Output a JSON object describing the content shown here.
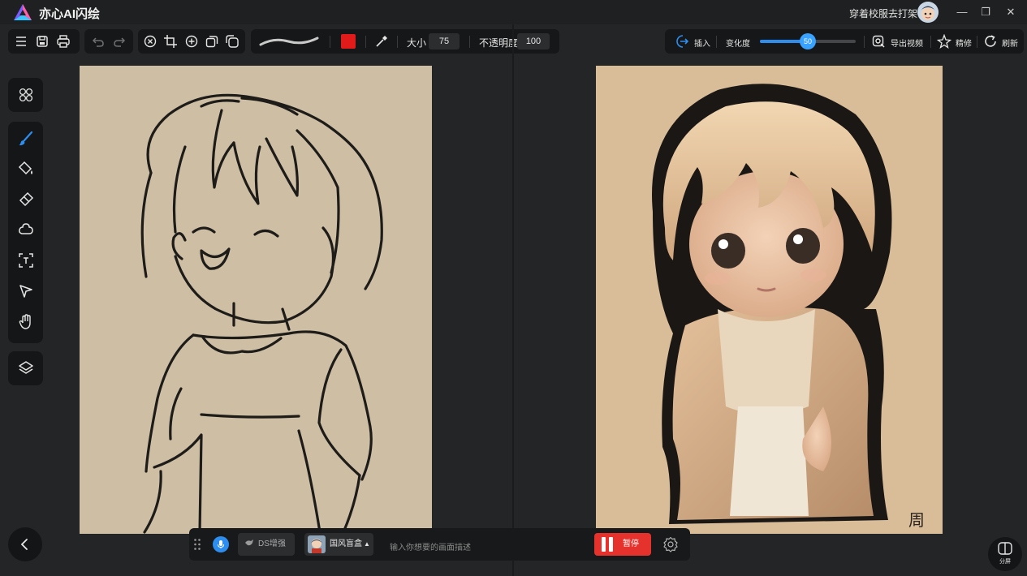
{
  "app": {
    "title": "亦心AI闪绘"
  },
  "user": {
    "name": "穿着校服去打架"
  },
  "window_controls": {
    "minimize": "—",
    "restore": "❐",
    "close": "✕"
  },
  "brush_toolbar": {
    "size_label": "大小",
    "size_value": "75",
    "opacity_label": "不透明度",
    "opacity_value": "100",
    "brush_color": "#e11a1a"
  },
  "right_toolbar": {
    "insert_label": "插入",
    "variation_label": "变化度",
    "variation_value": "50",
    "variation_fraction": 0.5,
    "export_video_label": "导出视频",
    "refine_label": "精修",
    "refresh_label": "刷新"
  },
  "prompt_bar": {
    "ds_enhance_label": "DS增强",
    "style_label": "国风盲盒",
    "style_caret": "▲",
    "prompt_placeholder": "输入你想要的画面描述",
    "pause_label": "暂停"
  },
  "split_screen": {
    "label": "分屏"
  },
  "colors": {
    "accent": "#2e8ef0",
    "pause": "#e5322c",
    "background": "#242526"
  }
}
